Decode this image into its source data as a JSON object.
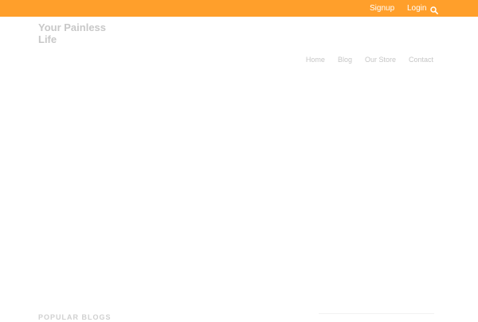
{
  "topbar": {
    "signup_label": "Signup",
    "login_label": "Login",
    "search_icon": "search-icon",
    "background": "#ff9f2b"
  },
  "header": {
    "site_title": "Your Painless Life"
  },
  "nav": {
    "items": [
      "Home",
      "Blog",
      "Our Store",
      "Contact"
    ]
  },
  "content": {
    "section_heading": "POPULAR BLOGS"
  }
}
